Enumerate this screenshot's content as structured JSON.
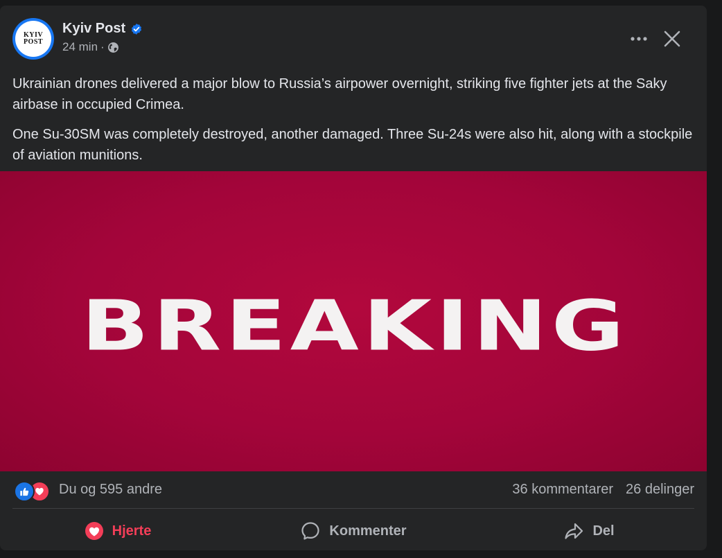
{
  "post": {
    "page_name": "Kyiv Post",
    "avatar_line1": "KYIV",
    "avatar_line2": "POST",
    "time": "24 min",
    "separator": "·",
    "privacy_icon": "globe-icon",
    "verified_icon": "verified-badge-icon",
    "paragraphs": [
      "Ukrainian drones delivered a major blow to Russia’s airpower overnight, striking five fighter jets at the Saky airbase in occupied Crimea.",
      "One Su-30SM was completely destroyed, another damaged. Three Su-24s were also hit, along with a stockpile of aviation munitions."
    ],
    "image_text": "BREAKING",
    "image_bg_color": "#a3053a"
  },
  "stats": {
    "reactions_text": "Du og 595 andre",
    "comments_text": "36 kommentarer",
    "shares_text": "26 delinger",
    "reaction_icons": [
      "like-icon",
      "love-icon"
    ]
  },
  "actions": {
    "love_label": "Hjerte",
    "comment_label": "Kommenter",
    "share_label": "Del"
  },
  "colors": {
    "card_bg": "#242526",
    "text_primary": "#e4e6eb",
    "text_secondary": "#b0b3b8",
    "love_red": "#f33e58",
    "like_blue": "#1b74e4",
    "verified_blue": "#1877f2"
  }
}
